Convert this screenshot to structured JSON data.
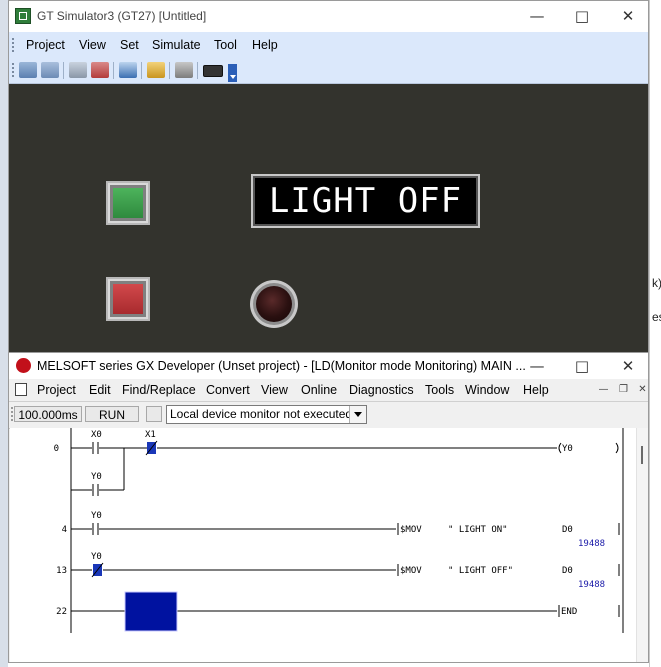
{
  "background": {
    "right_edge_text": [
      "k)",
      "es"
    ]
  },
  "gt_window": {
    "title": "GT Simulator3 (GT27)  [Untitled]",
    "menu": [
      "Project",
      "View",
      "Set",
      "Simulate",
      "Tool",
      "Help"
    ],
    "toolbar_icons": [
      "read-icon",
      "write-icon",
      "device-icon",
      "monitor-icon",
      "screen-icon",
      "exchange-icon",
      "setting-icon",
      "keyboard-icon"
    ],
    "screen": {
      "display_text": "LIGHT OFF",
      "colors": {
        "panel": "#33332d",
        "green_button": "#3c9a4a",
        "red_button": "#c1363a",
        "lamp": "#3b1a1a"
      }
    }
  },
  "gx_window": {
    "title": "MELSOFT series GX Developer (Unset project) - [LD(Monitor mode Monitoring)   MAIN  ...",
    "menu": [
      "Project",
      "Edit",
      "Find/Replace",
      "Convert",
      "View",
      "Online",
      "Diagnostics",
      "Tools",
      "Window",
      "Help"
    ],
    "status": {
      "scan_time": "100.000ms",
      "run_state": "RUN",
      "monitor_select": "Local device monitor not executed"
    },
    "ladder": {
      "rungs": [
        {
          "step": "0",
          "contacts": [
            "X0",
            "X1",
            "Y0"
          ],
          "coil": "Y0"
        },
        {
          "step": "4",
          "contacts": [
            "Y0"
          ],
          "instruction": "$MOV",
          "operand": "\" LIGHT ON\"",
          "dest": "D0",
          "monitor_value": "19488"
        },
        {
          "step": "13",
          "contacts": [
            "Y0"
          ],
          "instruction": "$MOV",
          "operand": "\" LIGHT OFF\"",
          "dest": "D0",
          "monitor_value": "19488"
        },
        {
          "step": "22",
          "end": "END"
        }
      ],
      "colors": {
        "energized": "#1a37b8",
        "cursor": "#0012a0",
        "value": "#1a1aa8"
      }
    }
  }
}
